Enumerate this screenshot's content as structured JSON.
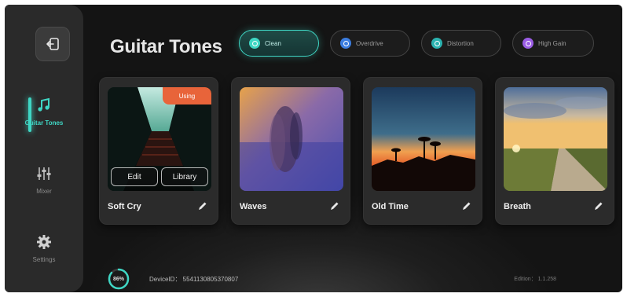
{
  "header": {
    "title": "Guitar Tones"
  },
  "tabs": [
    {
      "label": "Clean",
      "color": "#3fd6c4",
      "active": true
    },
    {
      "label": "Overdrive",
      "color": "#3b7de0",
      "active": false
    },
    {
      "label": "Distortion",
      "color": "#2bb3b0",
      "active": false
    },
    {
      "label": "High Gain",
      "color": "#9b5de5",
      "active": false
    }
  ],
  "sidebar": {
    "back_icon": "exit-icon",
    "items": [
      {
        "label": "Guitar Tones",
        "icon": "music-note-icon",
        "active": true
      },
      {
        "label": "Mixer",
        "icon": "sliders-icon",
        "active": false
      },
      {
        "label": "Settings",
        "icon": "gear-icon",
        "active": false
      }
    ]
  },
  "cards": [
    {
      "name": "Soft Cry",
      "badge": "Using",
      "edit_label": "Edit",
      "library_label": "Library"
    },
    {
      "name": "Waves"
    },
    {
      "name": "Old Time"
    },
    {
      "name": "Breath"
    }
  ],
  "footer": {
    "progress": "86%",
    "progress_value": 0.86,
    "device_id": "DeviceID： 554113080537080̈7",
    "edition": "Edition： 1.1.258"
  },
  "colors": {
    "accent": "#3fd6c4",
    "badge": "#e8643a"
  }
}
